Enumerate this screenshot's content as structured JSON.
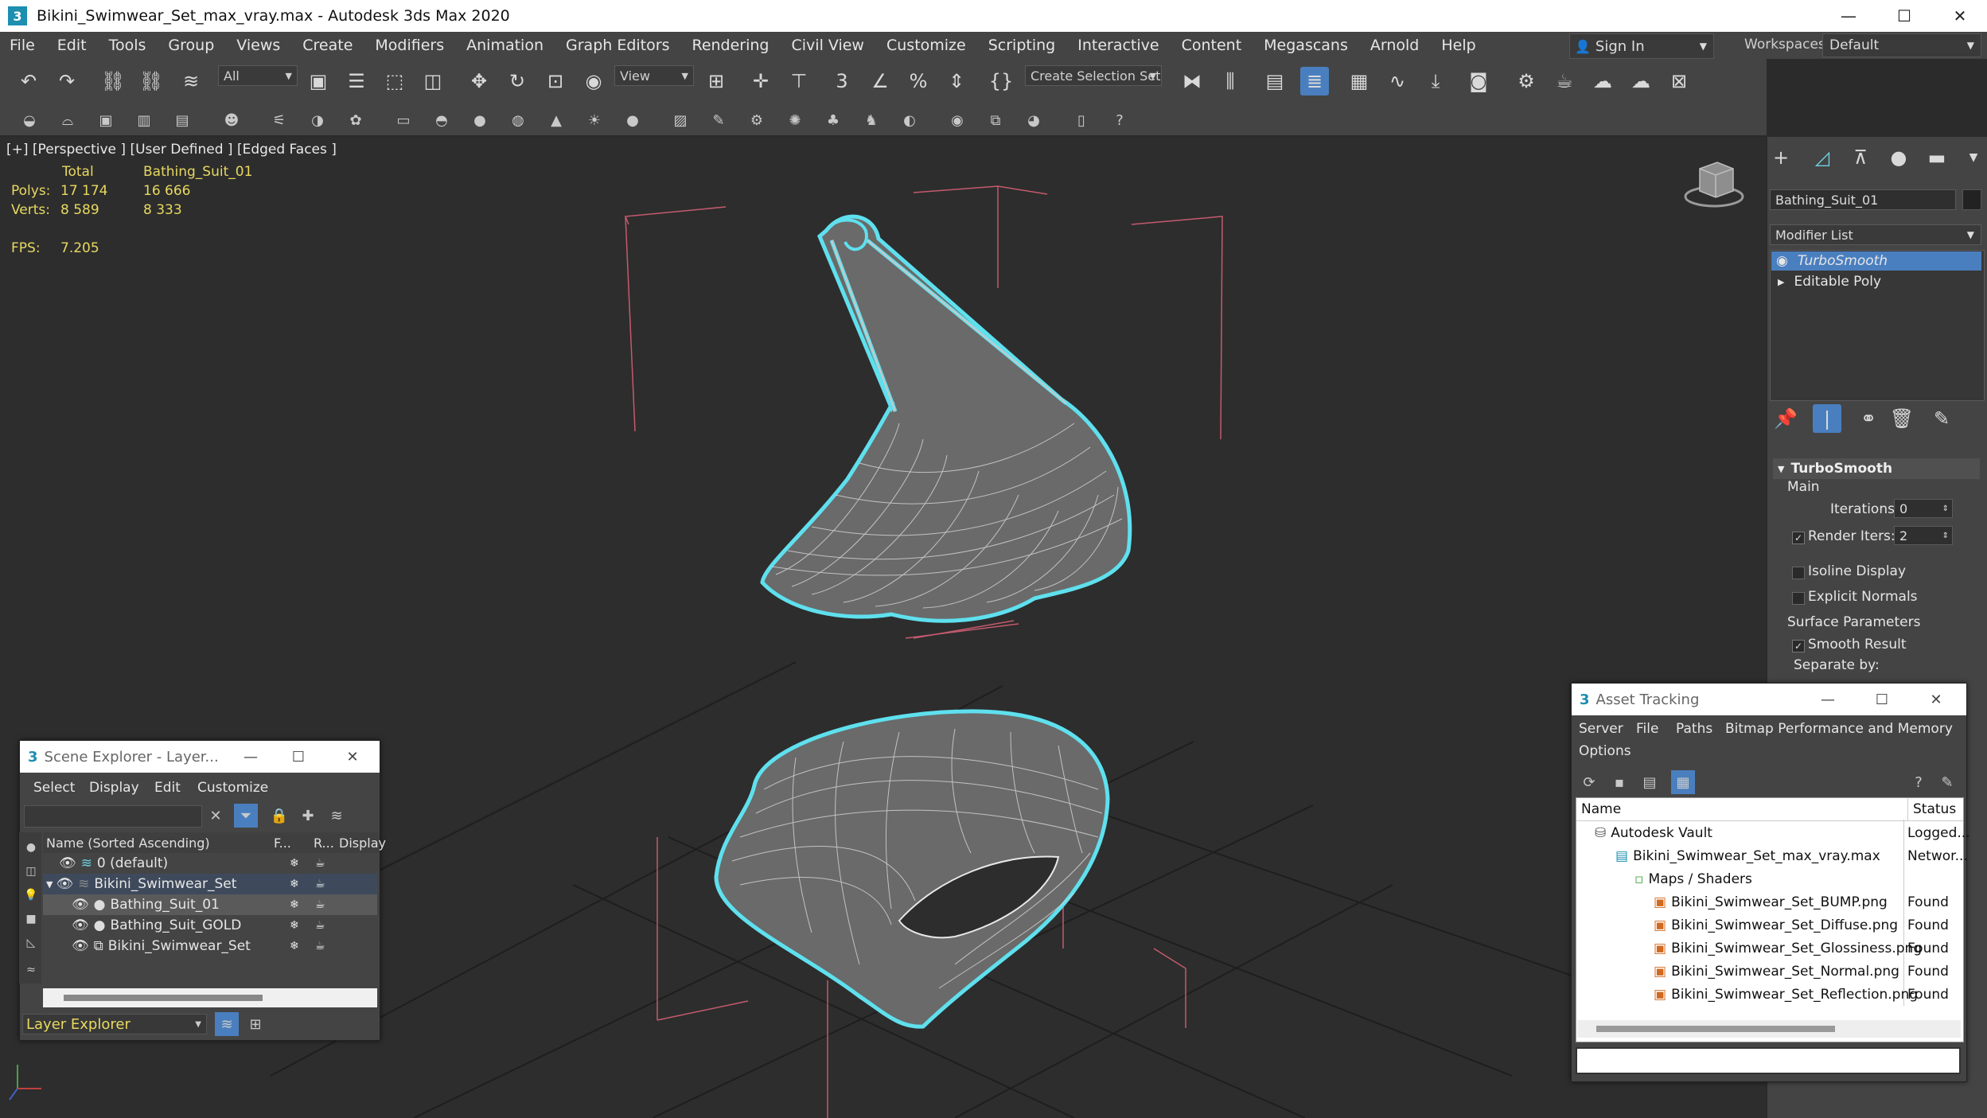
{
  "window": {
    "title": "Bikini_Swimwear_Set_max_vray.max - Autodesk 3ds Max 2020",
    "minimize": "—",
    "maximize": "☐",
    "close": "✕"
  },
  "menu": [
    "File",
    "Edit",
    "Tools",
    "Group",
    "Views",
    "Create",
    "Modifiers",
    "Animation",
    "Graph Editors",
    "Rendering",
    "Civil View",
    "Customize",
    "Scripting",
    "Interactive",
    "Content",
    "Megascans",
    "Arnold",
    "Help"
  ],
  "account": {
    "sign_in": "Sign In"
  },
  "workspaces": {
    "label": "Workspaces:",
    "value": "Default"
  },
  "toolbar": {
    "selection_filter": "All",
    "ref_coord": "View",
    "named_selection": "Create Selection Set"
  },
  "viewport": {
    "label": "[+] [Perspective ] [User Defined ] [Edged Faces ]",
    "stats": {
      "total_header": "Total",
      "object_header": "Bathing_Suit_01",
      "polys_label": "Polys:",
      "polys_total": "17 174",
      "polys_obj": "16 666",
      "verts_label": "Verts:",
      "verts_total": "8 589",
      "verts_obj": "8 333",
      "fps_label": "FPS:",
      "fps_value": "7.205"
    }
  },
  "command_panel": {
    "object_name": "Bathing_Suit_01",
    "modifier_list_label": "Modifier List",
    "stack": [
      "TurboSmooth",
      "Editable Poly"
    ],
    "rollout_title": "TurboSmooth",
    "main_label": "Main",
    "iterations_label": "Iterations:",
    "iterations_value": "0",
    "render_iters_label": "Render Iters:",
    "render_iters_value": "2",
    "isoline_label": "Isoline Display",
    "explicit_normals_label": "Explicit Normals",
    "surface_params_label": "Surface Parameters",
    "smooth_result_label": "Smooth Result",
    "separate_by_label": "Separate by:"
  },
  "scene_explorer": {
    "title": "Scene Explorer - Layer...",
    "menu": [
      "Select",
      "Display",
      "Edit",
      "Customize"
    ],
    "col_name": "Name (Sorted Ascending)",
    "col_f": "F...",
    "col_r": "R...",
    "col_display": "Display",
    "rows": [
      "0 (default)",
      "Bikini_Swimwear_Set",
      "Bathing_Suit_01",
      "Bathing_Suit_GOLD",
      "Bikini_Swimwear_Set"
    ],
    "footer": "Layer Explorer"
  },
  "asset_tracking": {
    "title": "Asset Tracking",
    "menu": [
      "Server",
      "File",
      "Paths",
      "Bitmap Performance and Memory",
      "Options"
    ],
    "col_name": "Name",
    "col_status": "Status",
    "rows": [
      {
        "name": "Autodesk Vault",
        "status": "Logged..."
      },
      {
        "name": "Bikini_Swimwear_Set_max_vray.max",
        "status": "Networ..."
      },
      {
        "name": "Maps / Shaders",
        "status": ""
      },
      {
        "name": "Bikini_Swimwear_Set_BUMP.png",
        "status": "Found"
      },
      {
        "name": "Bikini_Swimwear_Set_Diffuse.png",
        "status": "Found"
      },
      {
        "name": "Bikini_Swimwear_Set_Glossiness.png",
        "status": "Found"
      },
      {
        "name": "Bikini_Swimwear_Set_Normal.png",
        "status": "Found"
      },
      {
        "name": "Bikini_Swimwear_Set_Reflection.png",
        "status": "Found"
      }
    ]
  },
  "colors": {
    "selection_cyan": "#5fe0ee",
    "stat_yellow": "#e8d860",
    "highlight_blue": "#4a7fbf",
    "bbox_pink": "#c45a6e"
  }
}
